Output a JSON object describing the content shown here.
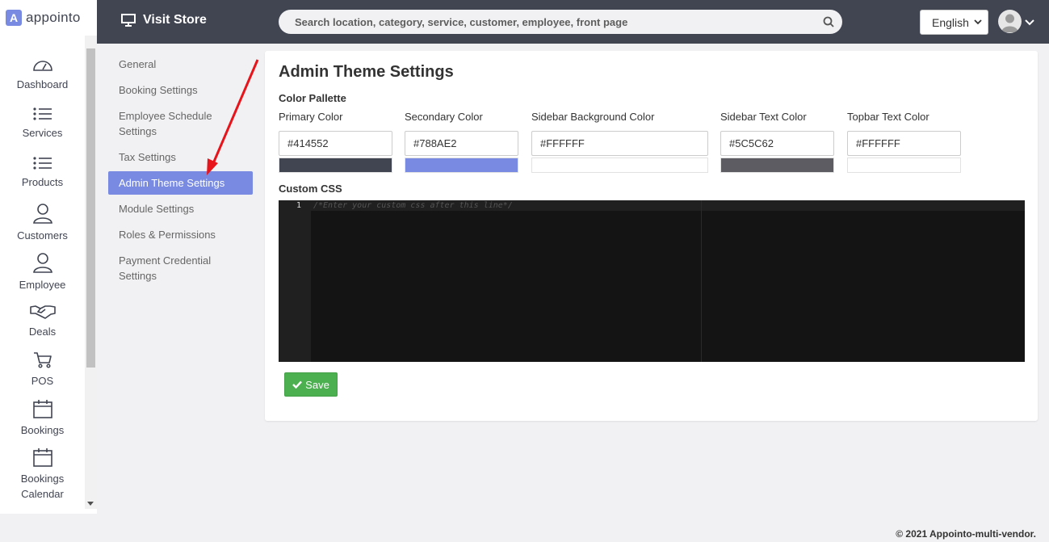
{
  "brand": {
    "mark": "A",
    "name": "appointo"
  },
  "topbar": {
    "visit_store": "Visit Store",
    "search_placeholder": "Search location, category, service, customer, employee, front page",
    "language": "English"
  },
  "sidebar": {
    "items": [
      {
        "label": "Dashboard",
        "icon": "dashboard-icon"
      },
      {
        "label": "Services",
        "icon": "list-icon"
      },
      {
        "label": "Products",
        "icon": "list-icon"
      },
      {
        "label": "Customers",
        "icon": "user-icon"
      },
      {
        "label": "Employee",
        "icon": "user-icon"
      },
      {
        "label": "Deals",
        "icon": "handshake-icon"
      },
      {
        "label": "POS",
        "icon": "cart-icon"
      },
      {
        "label": "Bookings",
        "icon": "calendar-icon"
      },
      {
        "label": "Bookings",
        "label2": "Calendar",
        "icon": "calendar-icon"
      }
    ]
  },
  "settings_menu": {
    "items": [
      {
        "label": "General"
      },
      {
        "label": "Booking Settings"
      },
      {
        "label": "Employee Schedule",
        "label2": "Settings"
      },
      {
        "label": "Tax Settings"
      },
      {
        "label": "Admin Theme Settings",
        "active": true
      },
      {
        "label": "Module Settings"
      },
      {
        "label": "Roles & Permissions"
      },
      {
        "label": "Payment Credential",
        "label2": "Settings"
      }
    ]
  },
  "main": {
    "title": "Admin Theme Settings",
    "palette_title": "Color Pallette",
    "colors": [
      {
        "label": "Primary Color",
        "value": "#414552",
        "swatch": "#414552"
      },
      {
        "label": "Secondary Color",
        "value": "#788AE2",
        "swatch": "#788AE2"
      },
      {
        "label": "Sidebar Background Color",
        "value": "#FFFFFF",
        "swatch": "#FFFFFF"
      },
      {
        "label": "Sidebar Text Color",
        "value": "#5C5C62",
        "swatch": "#5C5C62"
      },
      {
        "label": "Topbar Text Color",
        "value": "#FFFFFF",
        "swatch": "#FFFFFF"
      }
    ],
    "custom_css_title": "Custom CSS",
    "editor": {
      "line_number": "1",
      "code": "/*Enter your custom css after this line*/"
    },
    "save_label": "Save"
  },
  "footer": {
    "text": "© 2021 Appointo-multi-vendor."
  },
  "annotation": {
    "color": "#e8141b"
  }
}
